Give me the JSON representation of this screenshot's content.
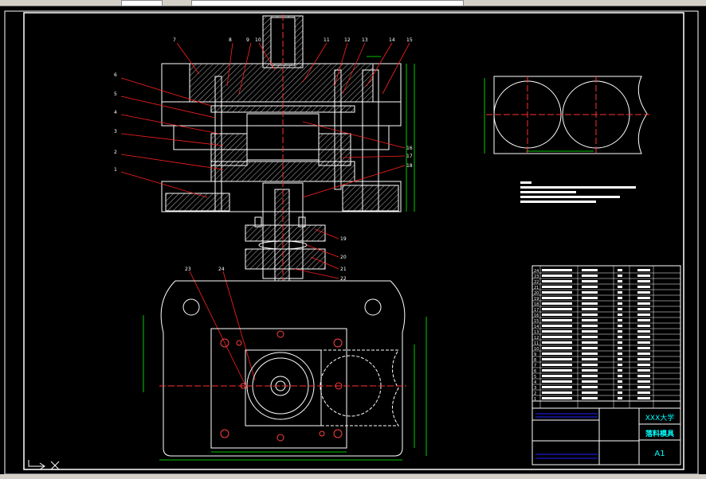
{
  "title_block": {
    "school": "XXX大学",
    "drawing_name": "落料模具",
    "sheet_size": "A1"
  },
  "callouts": {
    "top": [
      "7",
      "8",
      "9",
      "10",
      "11",
      "12",
      "13",
      "14",
      "15"
    ],
    "left": [
      "6",
      "5",
      "4",
      "3",
      "2",
      "1"
    ],
    "right": [
      "16",
      "17",
      "18"
    ],
    "lower": [
      "19",
      "20",
      "21",
      "22"
    ],
    "plan": [
      "23",
      "24"
    ]
  },
  "parts_list": {
    "rows": [
      "24",
      "23",
      "22",
      "21",
      "20",
      "19",
      "18",
      "17",
      "16",
      "15",
      "14",
      "13",
      "12",
      "11",
      "10",
      "9",
      "8",
      "7",
      "6",
      "5",
      "4",
      "3",
      "2",
      "1"
    ]
  },
  "colors": {
    "background": "#000000",
    "lines": "#ffffff",
    "leaders": "#ff2020",
    "dimensions": "#00ff00",
    "centerlines": "#ff3030",
    "title_text": "#00ffff",
    "table_rules": "#2020ff"
  }
}
